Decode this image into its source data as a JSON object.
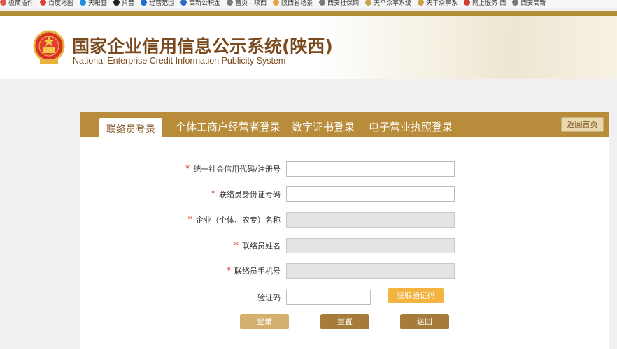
{
  "bookmarks": [
    {
      "label": "极简插件",
      "color": "#e0564a"
    },
    {
      "label": "百度地图",
      "color": "#e2403a"
    },
    {
      "label": "天眼查",
      "color": "#1e8fe6"
    },
    {
      "label": "抖音",
      "color": "#222222"
    },
    {
      "label": "经营范围",
      "color": "#1e6fd0"
    },
    {
      "label": "高新公积金",
      "color": "#2a6ac6"
    },
    {
      "label": "首页 - 陕西",
      "color": "#7a7a7a"
    },
    {
      "label": "陕西省场景",
      "color": "#e6a23c"
    },
    {
      "label": "西安社保网",
      "color": "#7a7a7a"
    },
    {
      "label": "天平众享系统",
      "color": "#c8a24a"
    },
    {
      "label": "天平众享系",
      "color": "#c8a24a"
    },
    {
      "label": "网上服务-西",
      "color": "#d23b2f"
    },
    {
      "label": "西安高新",
      "color": "#7a7a7a"
    }
  ],
  "header": {
    "title_cn": "国家企业信用信息公示系统(陕西)",
    "title_en": "National Enterprise Credit Information Publicity System"
  },
  "tabs": {
    "contact_login": "联络员登录",
    "individual_login": "个体工商户经营者登录",
    "digital_cert_login": "数字证书登录",
    "e_license_login": "电子营业执照登录",
    "home": "返回首页"
  },
  "form": {
    "credit_code_label": "统一社会信用代码/注册号",
    "credit_code_value": "",
    "contact_id_label": "联络员身份证号码",
    "contact_id_value": "",
    "company_name_label": "企业（个体、农专）名称",
    "contact_name_label": "联络员姓名",
    "contact_phone_label": "联络员手机号",
    "captcha_label": "验证码",
    "captcha_value": "",
    "get_code": "获取验证码",
    "required_mark": "*"
  },
  "buttons": {
    "login": "登录",
    "reset": "重置",
    "back": "返回"
  },
  "colors": {
    "accent_gold": "#b88c3b",
    "title_brown": "#7a4a1e",
    "required_red": "#d9302a",
    "get_code_orange": "#f2b340"
  }
}
